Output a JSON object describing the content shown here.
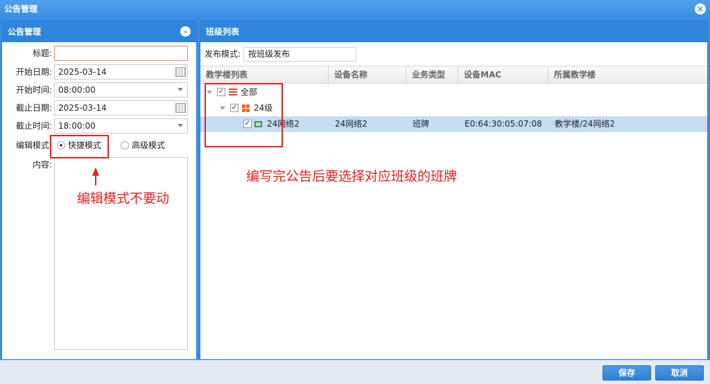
{
  "window": {
    "title": "公告管理",
    "close_icon": "close-circle-icon"
  },
  "left_panel": {
    "title": "公告管理",
    "collapse_icon": "chevron-left-circle-icon",
    "fields": {
      "title_label": "标题:",
      "title_value": "",
      "start_date_label": "开始日期:",
      "start_date_value": "2025-03-14",
      "start_time_label": "开始时间:",
      "start_time_value": "08:00:00",
      "end_date_label": "截止日期:",
      "end_date_value": "2025-03-14",
      "end_time_label": "截止时间:",
      "end_time_value": "18:00:00",
      "edit_mode_label": "编辑模式",
      "edit_mode_quick": "快捷模式",
      "edit_mode_advanced": "高级模式",
      "edit_mode_selected": "快捷模式",
      "content_label": "内容:"
    }
  },
  "right_panel": {
    "title": "班级列表",
    "publish_mode_label": "发布模式:",
    "publish_mode_value": "按班级发布",
    "columns": [
      "教学楼列表",
      "设备名称",
      "业务类型",
      "设备MAC",
      "所属教学楼"
    ],
    "tree": [
      {
        "label": "全部",
        "level": 0,
        "checked": true,
        "icon": "list-icon"
      },
      {
        "label": "24级",
        "level": 1,
        "checked": true,
        "icon": "grid-icon"
      },
      {
        "label": "24网络2",
        "level": 2,
        "checked": true,
        "icon": "screen-icon",
        "device": "24网络2",
        "type": "班牌",
        "mac": "E0:64:30:05:07:08",
        "building": "教学楼/24网络2",
        "selected": true
      }
    ]
  },
  "annotations": {
    "edit_mode_note": "编辑模式不要动",
    "class_note": "编写完公告后要选择对应班级的班牌",
    "color": "#e8201a"
  },
  "footer": {
    "save_label": "保存",
    "cancel_label": "取消"
  },
  "colors": {
    "accent": "#2d86db",
    "selection": "#c6ddf3",
    "annotation": "#e8201a"
  }
}
